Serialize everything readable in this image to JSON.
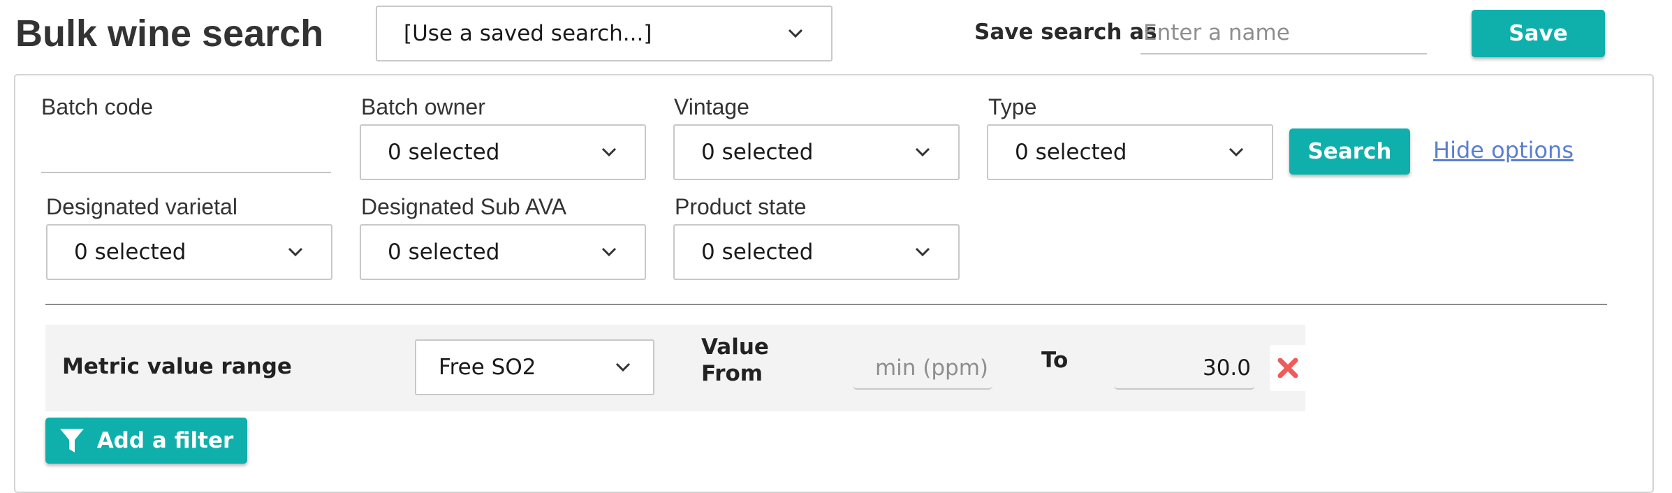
{
  "header": {
    "title": "Bulk wine search",
    "saved_search_placeholder": "[Use a saved search...]",
    "save_as_label": "Save search as",
    "save_as_placeholder": "Enter a name",
    "save_button": "Save"
  },
  "filters": {
    "batch_code": {
      "label": "Batch code",
      "value": ""
    },
    "batch_owner": {
      "label": "Batch owner",
      "selected": "0 selected"
    },
    "vintage": {
      "label": "Vintage",
      "selected": "0 selected"
    },
    "type": {
      "label": "Type",
      "selected": "0 selected"
    },
    "designated_varietal": {
      "label": "Designated varietal",
      "selected": "0 selected"
    },
    "designated_sub_ava": {
      "label": "Designated Sub AVA",
      "selected": "0 selected"
    },
    "product_state": {
      "label": "Product state",
      "selected": "0 selected"
    },
    "search_button": "Search",
    "hide_options_link": "Hide options"
  },
  "metric_filter": {
    "label": "Metric value range",
    "metric": "Free SO2",
    "value_from_line1": "Value",
    "value_from_line2": "From",
    "min_placeholder": "min (ppm)",
    "min_value": "",
    "to_label": "To",
    "max_value": "30.0"
  },
  "add_filter_button": "Add a filter",
  "colors": {
    "accent": "#0fb0ab",
    "link": "#5a7fd0",
    "remove": "#f05a5a",
    "filter_row_bg": "#f3f3f3"
  },
  "icons": {
    "dropdown": "chevron-down-icon",
    "remove": "close-x-icon",
    "add_filter": "funnel-icon"
  }
}
